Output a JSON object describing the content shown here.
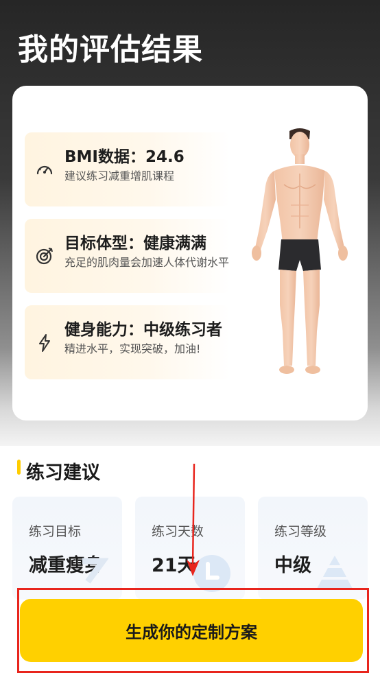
{
  "page": {
    "title": "我的评估结果"
  },
  "metrics": [
    {
      "icon": "gauge-icon",
      "title": "BMI数据：24.6",
      "desc": "建议练习减重增肌课程"
    },
    {
      "icon": "target-icon",
      "title": "目标体型：健康满满",
      "desc": "充足的肌肉量会加速人体代谢水平"
    },
    {
      "icon": "lightning-icon",
      "title": "健身能力：中级练习者",
      "desc": "精进水平，实现突破，加油!"
    }
  ],
  "advice": {
    "title": "练习建议",
    "cards": [
      {
        "label": "练习目标",
        "value": "减重瘦身"
      },
      {
        "label": "练习天数",
        "value": "21天"
      },
      {
        "label": "练习等级",
        "value": "中级"
      }
    ]
  },
  "cta": {
    "label": "生成你的定制方案"
  },
  "colors": {
    "accent": "#ffd000",
    "highlight_frame": "#e8251d",
    "annotation_arrow": "#e8251d"
  }
}
